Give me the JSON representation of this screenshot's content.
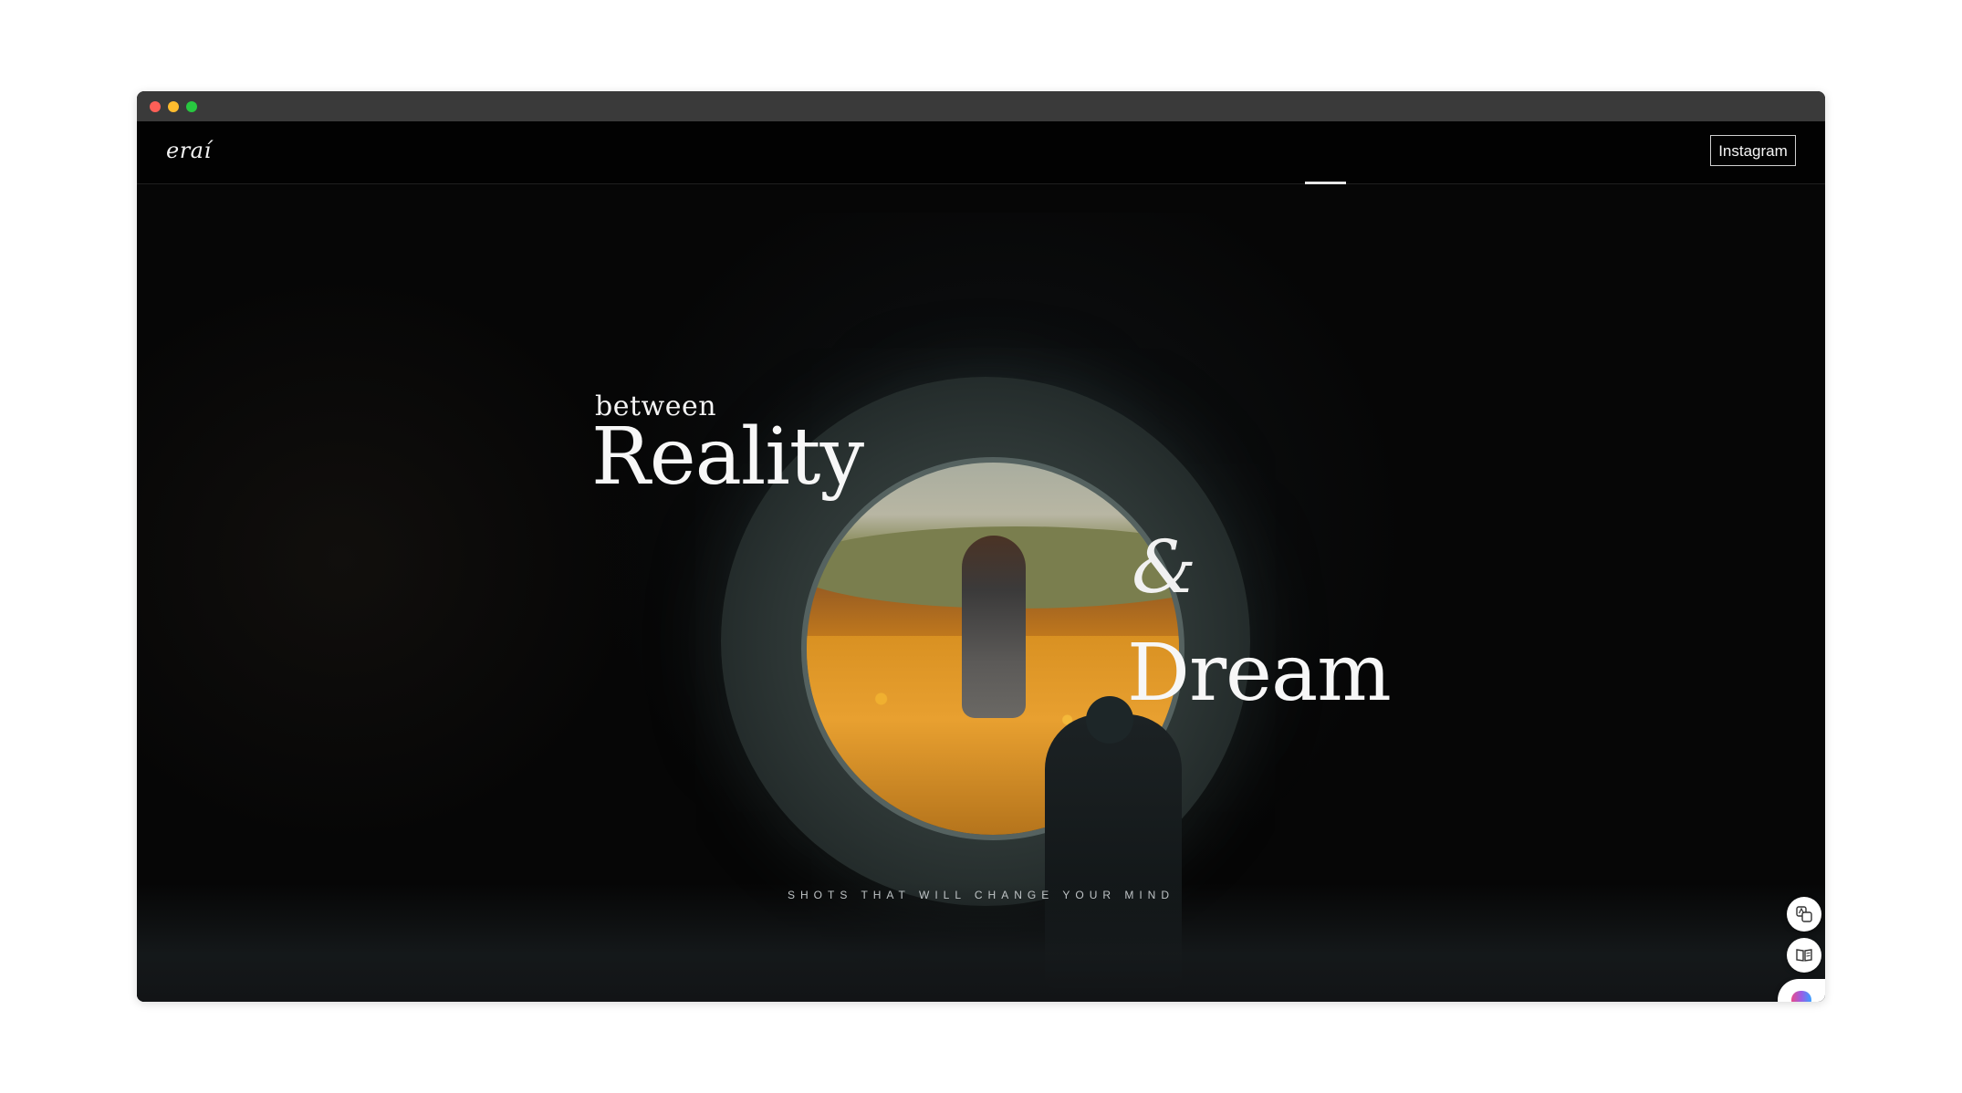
{
  "site": {
    "logo": "eraí",
    "nav_button": "Instagram"
  },
  "hero": {
    "line_small": "between",
    "line_big_1": "Reality",
    "ampersand": "&",
    "line_big_2": "Dream",
    "tagline": "SHOTS THAT WILL CHANGE YOUR MIND"
  },
  "floating_tools": [
    {
      "icon": "translate-icon"
    },
    {
      "icon": "reader-icon"
    },
    {
      "icon": "brain-icon"
    }
  ]
}
